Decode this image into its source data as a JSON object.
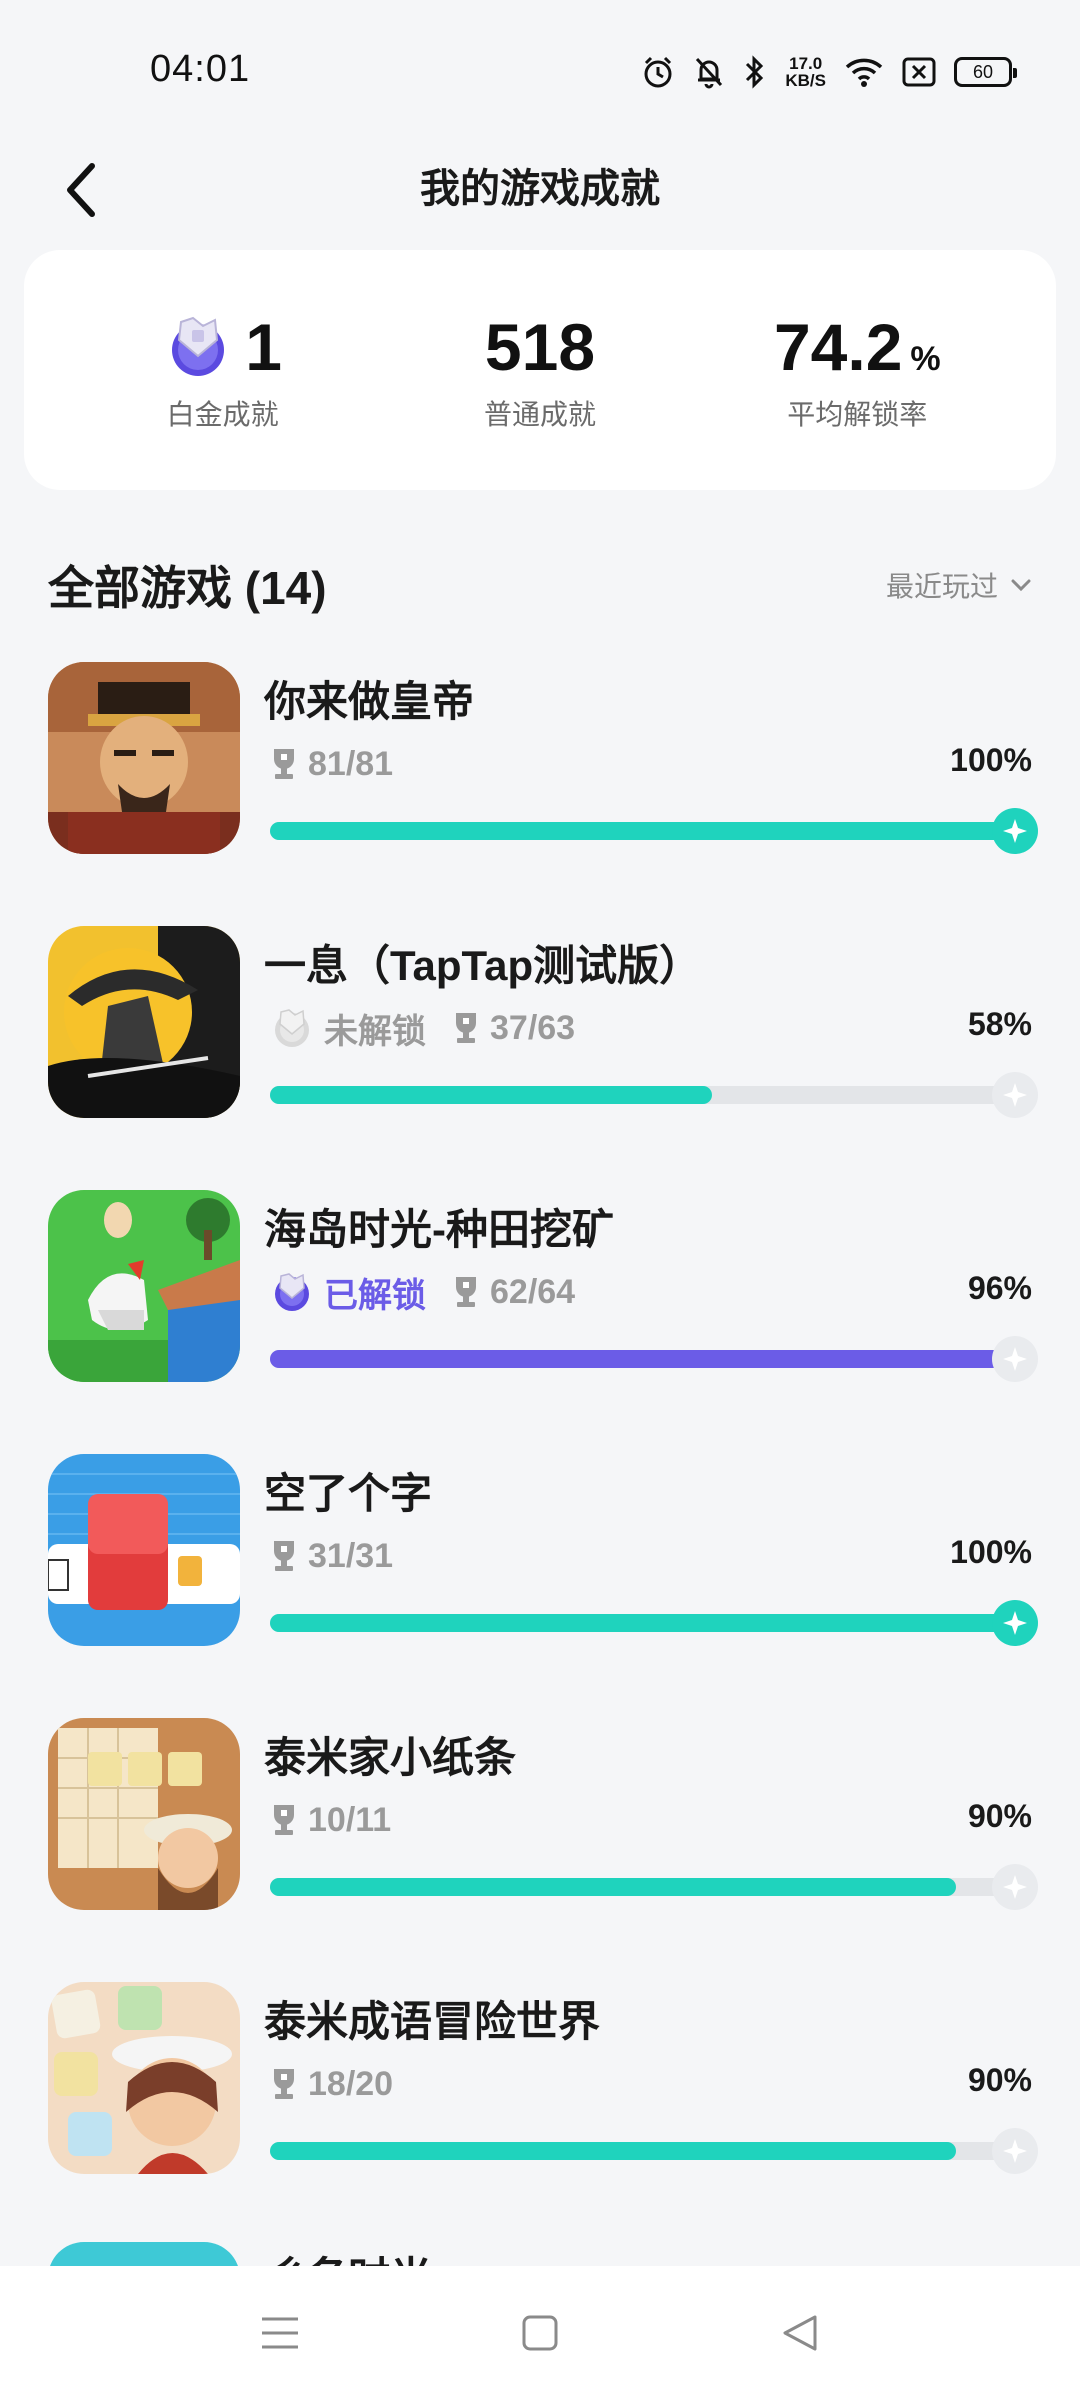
{
  "status_bar": {
    "time": "04:01",
    "net_speed_value": "17.0",
    "net_speed_unit": "KB/S",
    "battery": "60"
  },
  "header": {
    "title": "我的游戏成就"
  },
  "summary": {
    "platinum": {
      "value": "1",
      "label": "白金成就"
    },
    "normal": {
      "value": "518",
      "label": "普通成就"
    },
    "unlock_rate": {
      "value": "74.2",
      "unit": "%",
      "label": "平均解锁率"
    }
  },
  "section": {
    "title": "全部游戏 (14)",
    "sort_label": "最近玩过"
  },
  "games": [
    {
      "name": "你来做皇帝",
      "platinum_status": "",
      "trophies": "81/81",
      "percent_label": "100%",
      "progress": 1.0,
      "complete": true,
      "platinum_unlocked": false
    },
    {
      "name": "一息（TapTap测试版）",
      "platinum_status": "未解锁",
      "trophies": "37/63",
      "percent_label": "58%",
      "progress": 0.58,
      "complete": false,
      "platinum_unlocked": false
    },
    {
      "name": "海岛时光-种田挖矿",
      "platinum_status": "已解锁",
      "trophies": "62/64",
      "percent_label": "96%",
      "progress": 0.96,
      "complete": false,
      "platinum_unlocked": true
    },
    {
      "name": "空了个字",
      "platinum_status": "",
      "trophies": "31/31",
      "percent_label": "100%",
      "progress": 1.0,
      "complete": true,
      "platinum_unlocked": false
    },
    {
      "name": "泰米家小纸条",
      "platinum_status": "",
      "trophies": "10/11",
      "percent_label": "90%",
      "progress": 0.9,
      "complete": false,
      "platinum_unlocked": false
    },
    {
      "name": "泰米成语冒险世界",
      "platinum_status": "",
      "trophies": "18/20",
      "percent_label": "90%",
      "progress": 0.9,
      "complete": false,
      "platinum_unlocked": false
    }
  ],
  "partial_game": {
    "name": "ㄔ名时光"
  },
  "colors": {
    "accent_teal": "#1fd3bd",
    "accent_purple": "#6b5ce7",
    "background": "#f5f6f8"
  },
  "icons": {
    "back": "chevron-left-icon",
    "sort": "chevron-down-icon",
    "trophy": "trophy-icon",
    "platinum": "platinum-badge-icon",
    "progress_end": "star-icon"
  }
}
